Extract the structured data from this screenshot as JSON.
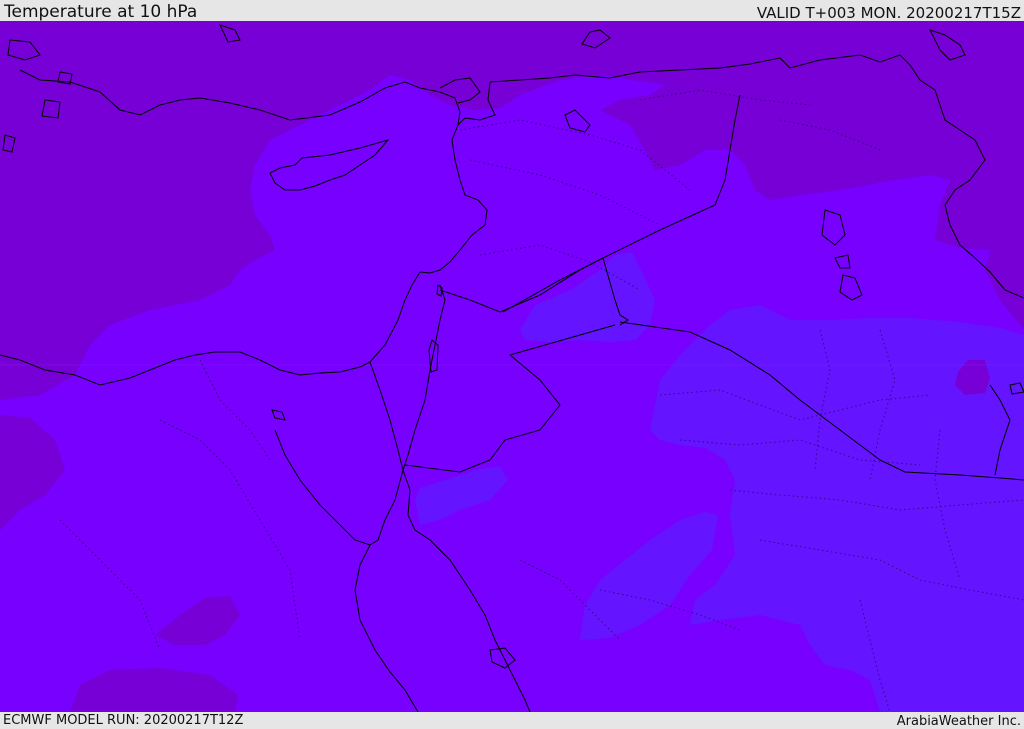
{
  "header": {
    "title": "Temperature at 10 hPa",
    "valid_time": "VALID T+003 MON. 20200217T15Z"
  },
  "footer": {
    "model_run": "ECMWF MODEL RUN: 20200217T12Z",
    "credit": "ArabiaWeather Inc."
  },
  "map": {
    "colors": {
      "warm_fill": "#7700d6",
      "base_fill": "#7700ff",
      "cool_fill": "#6414ff",
      "coastline": "#000000"
    }
  }
}
